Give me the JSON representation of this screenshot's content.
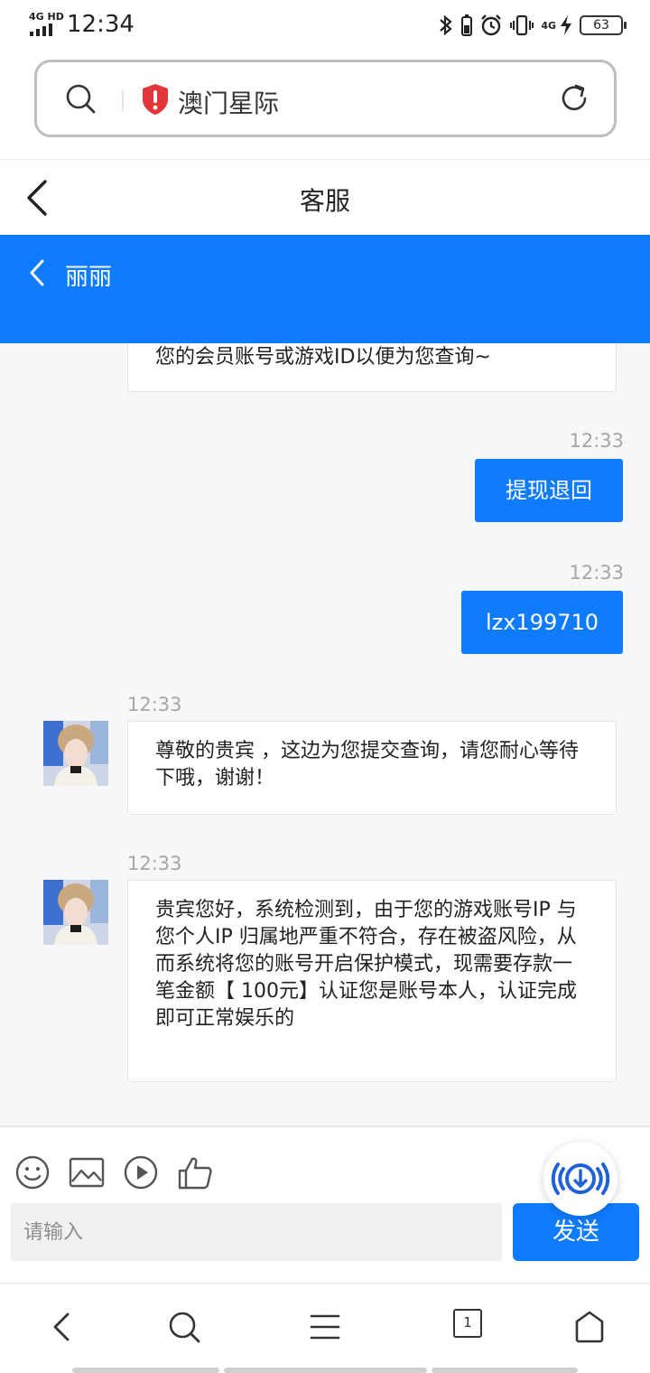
{
  "status_bar": {
    "network": "4G HD",
    "time": "12:34",
    "network_right": "4G",
    "battery": "63"
  },
  "browser": {
    "site_name": "澳门星际"
  },
  "page": {
    "title": "客服"
  },
  "chat": {
    "agent_name": "丽丽",
    "messages": [
      {
        "side": "left",
        "text": "您的会员账号或游戏ID以便为您查询~"
      },
      {
        "side": "right",
        "time": "12:33",
        "text": "提现退回"
      },
      {
        "side": "right",
        "time": "12:33",
        "text": "lzx199710"
      },
      {
        "side": "left",
        "time": "12:33",
        "text": "尊敬的贵宾 ，这边为您提交查询，请您耐心等待下哦，谢谢！"
      },
      {
        "side": "left",
        "time": "12:33",
        "text": "贵宾您好，系统检测到，由于您的游戏账号IP 与您个人IP 归属地严重不符合，存在被盗风险，从而系统将您的账号开启保护模式，现需要存款一笔金额【 100元】认证您是账号本人，认证完成 即可正常娱乐的"
      }
    ]
  },
  "composer": {
    "placeholder": "请输入",
    "send_label": "发送",
    "tools": [
      "emoji-icon",
      "image-icon",
      "play-icon",
      "thumbs-up-icon"
    ]
  },
  "bottom_nav": {
    "tab_count": "1"
  },
  "colors": {
    "accent": "#0f7bff",
    "chat_bg": "#f7f7f9"
  }
}
